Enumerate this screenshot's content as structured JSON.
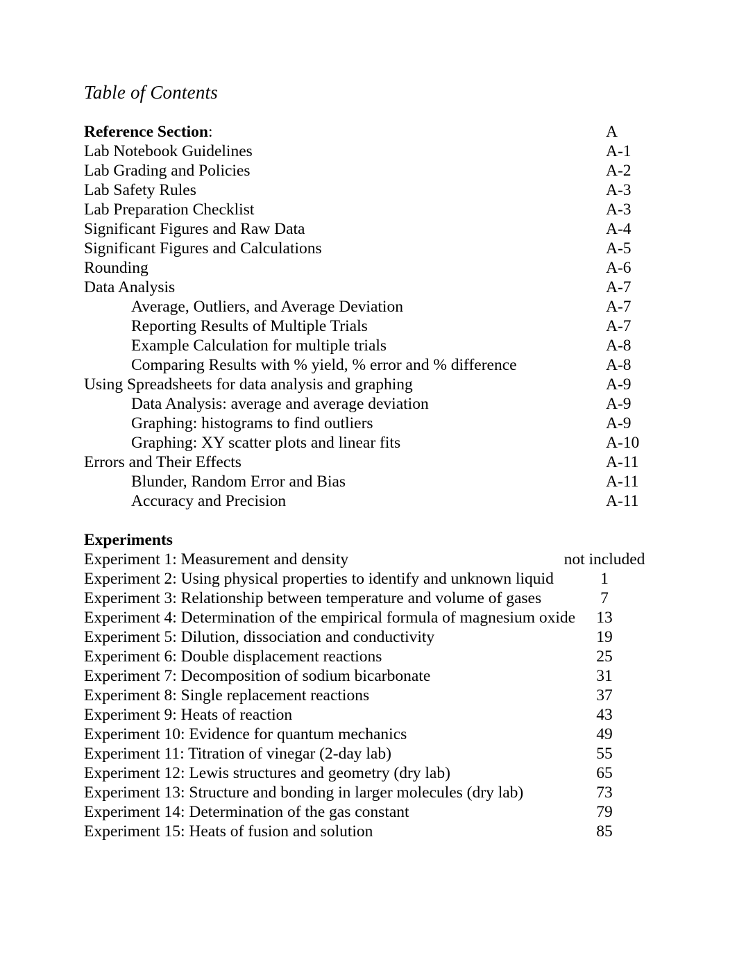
{
  "document": {
    "title": "Table of Contents"
  },
  "reference_section": {
    "heading_bold": "Reference Section",
    "heading_plain": ":",
    "heading_page": "A",
    "entries": [
      {
        "label": "Lab Notebook Guidelines",
        "page": "A-1",
        "indent": false
      },
      {
        "label": "Lab Grading and Policies",
        "page": "A-2",
        "indent": false
      },
      {
        "label": "Lab Safety Rules",
        "page": "A-3",
        "indent": false
      },
      {
        "label": "Lab Preparation Checklist",
        "page": "A-3",
        "indent": false
      },
      {
        "label": "Significant Figures and Raw Data",
        "page": "A-4",
        "indent": false
      },
      {
        "label": "Significant Figures and Calculations",
        "page": "A-5",
        "indent": false
      },
      {
        "label": "Rounding",
        "page": "A-6",
        "indent": false
      },
      {
        "label": "Data Analysis",
        "page": "A-7",
        "indent": false
      },
      {
        "label": "Average, Outliers, and Average Deviation",
        "page": "A-7",
        "indent": true
      },
      {
        "label": "Reporting Results of Multiple Trials",
        "page": "A-7",
        "indent": true
      },
      {
        "label": "Example Calculation for multiple trials",
        "page": "A-8",
        "indent": true
      },
      {
        "label": "Comparing Results with % yield, % error and % difference",
        "page": "A-8",
        "indent": true
      },
      {
        "label": "Using Spreadsheets for data analysis and graphing",
        "page": "A-9",
        "indent": false
      },
      {
        "label": "Data Analysis: average and average deviation",
        "page": "A-9",
        "indent": true
      },
      {
        "label": "Graphing: histograms to find outliers",
        "page": "A-9",
        "indent": true
      },
      {
        "label": "Graphing: XY scatter plots and linear fits",
        "page": "A-10",
        "indent": true
      },
      {
        "label": "Errors and Their Effects",
        "page": "A-11",
        "indent": false
      },
      {
        "label": "Blunder, Random Error and Bias",
        "page": "A-11",
        "indent": true
      },
      {
        "label": "Accuracy and Precision",
        "page": "A-11",
        "indent": true
      }
    ]
  },
  "experiments_section": {
    "heading": "Experiments",
    "entries": [
      {
        "label": "Experiment 1: Measurement and density",
        "page": "not included"
      },
      {
        "label": "Experiment 2: Using physical properties to identify and unknown liquid",
        "page": "1"
      },
      {
        "label": "Experiment 3: Relationship between temperature and volume of gases",
        "page": "7"
      },
      {
        "label": "Experiment 4: Determination of the empirical formula of magnesium oxide",
        "page": "13"
      },
      {
        "label": "Experiment 5: Dilution, dissociation and conductivity",
        "page": "19"
      },
      {
        "label": "Experiment 6: Double displacement reactions",
        "page": "25"
      },
      {
        "label": "Experiment 7: Decomposition of sodium bicarbonate",
        "page": "31"
      },
      {
        "label": "Experiment 8: Single replacement reactions",
        "page": "37"
      },
      {
        "label": "Experiment 9: Heats of reaction",
        "page": "43"
      },
      {
        "label": "Experiment 10: Evidence for quantum mechanics",
        "page": "49"
      },
      {
        "label": "Experiment 11: Titration of vinegar (2-day lab)",
        "page": "55"
      },
      {
        "label": "Experiment 12: Lewis structures and geometry (dry lab)",
        "page": "65"
      },
      {
        "label": "Experiment 13: Structure and bonding in larger molecules (dry lab)",
        "page": "73"
      },
      {
        "label": "Experiment 14: Determination of the gas constant",
        "page": "79"
      },
      {
        "label": "Experiment 15: Heats of fusion and solution",
        "page": "85"
      }
    ]
  }
}
